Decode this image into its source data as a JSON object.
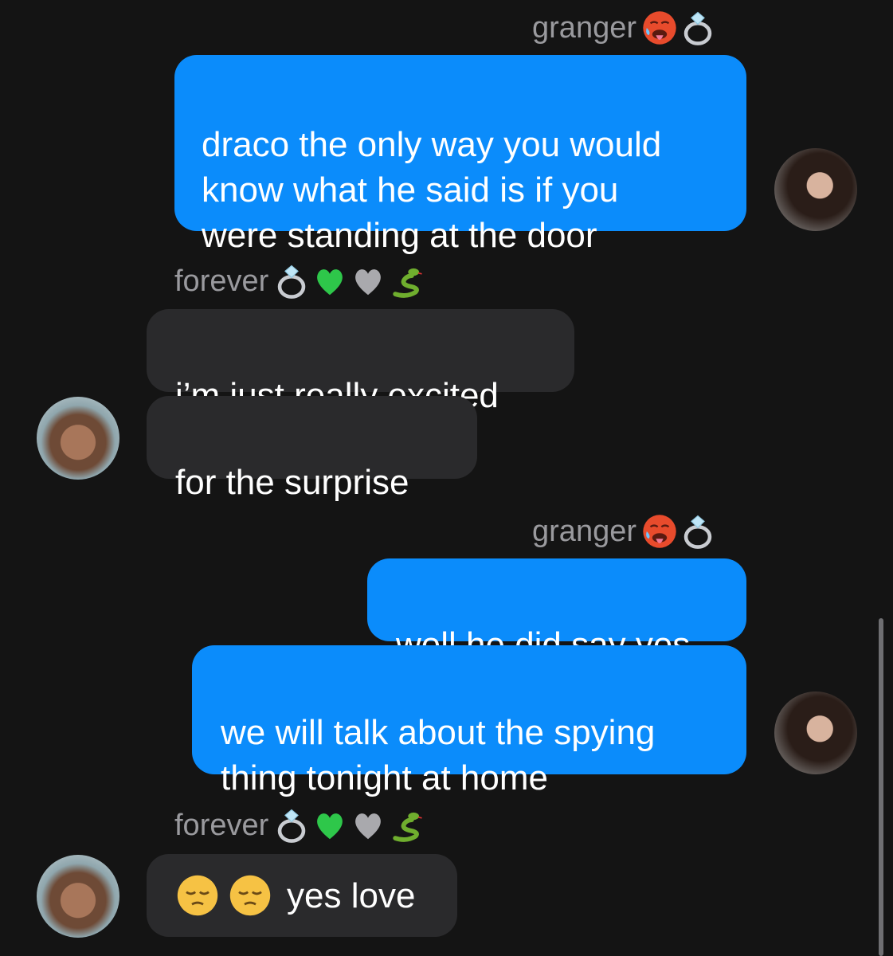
{
  "messages": [
    {
      "sender": "granger",
      "direction": "outgoing",
      "sender_emoji": [
        "hot-face-emoji",
        "ring-emoji"
      ],
      "bubbles": [
        "draco the only way you would\nknow what he said is if you\nwere standing at the door"
      ]
    },
    {
      "sender": "forever",
      "direction": "incoming",
      "sender_emoji": [
        "ring-emoji",
        "green-heart-emoji",
        "grey-heart-emoji",
        "snake-emoji"
      ],
      "bubbles": [
        "i’m just really excited",
        "for the surprise"
      ]
    },
    {
      "sender": "granger",
      "direction": "outgoing",
      "sender_emoji": [
        "hot-face-emoji",
        "ring-emoji"
      ],
      "bubbles": [
        "well he did say yes",
        "we will talk about the spying\nthing tonight at home"
      ]
    },
    {
      "sender": "forever",
      "direction": "incoming",
      "sender_emoji": [
        "ring-emoji",
        "green-heart-emoji",
        "grey-heart-emoji",
        "snake-emoji"
      ],
      "bubbles": [
        "yes love"
      ],
      "bubble_emoji": [
        "pensive-face-emoji",
        "pensive-face-emoji"
      ]
    }
  ],
  "colors": {
    "background": "#141414",
    "outgoing_bubble": "#0b8cfb",
    "incoming_bubble": "#2a2a2c",
    "sender_name": "#9a9a9e"
  }
}
